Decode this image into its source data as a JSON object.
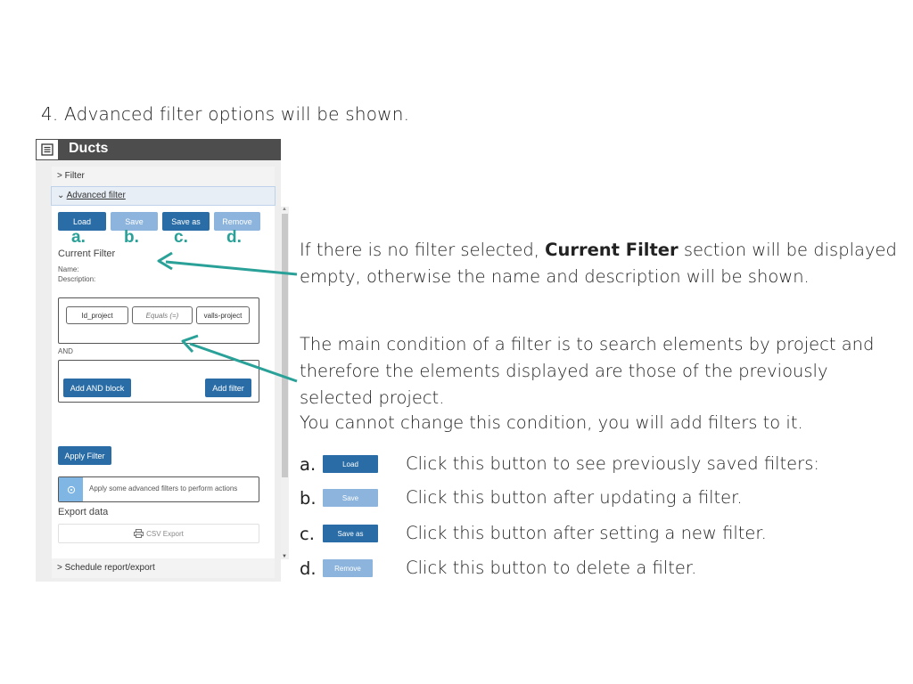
{
  "step_text": "4. Advanced filter options will be shown.",
  "panel": {
    "title": "Ducts",
    "filter_row": "> Filter",
    "advanced_chevron": "⌄",
    "advanced_label": "Advanced filter",
    "buttons": {
      "load": "Load",
      "save": "Save",
      "save_as": "Save as",
      "remove": "Remove"
    },
    "letters": [
      "a.",
      "b.",
      "c.",
      "d."
    ],
    "current_filter": {
      "title": "Current Filter",
      "name_label": "Name:",
      "description_label": "Description:"
    },
    "condition": {
      "field": "Id_project",
      "operator": "Equals (=)",
      "value": "valls-project"
    },
    "and_label": "AND",
    "add_and_block": "Add AND block",
    "add_filter": "Add filter",
    "apply_filter": "Apply Filter",
    "notice_text": "Apply some advanced filters to perform actions",
    "export_title": "Export data",
    "csv_export": "CSV Export",
    "schedule_row": "> Schedule report/export"
  },
  "paragraphs": {
    "p1_before": "If there is no filter selected, ",
    "p1_bold": "Current Filter",
    "p1_after": " section will be displayed empty, otherwise the name and description will be shown.",
    "p2": "The main condition of a filter is to search elements by project and therefore the elements displayed are those of the previously selected project.",
    "p3": "You cannot change this condition, you will add filters to it."
  },
  "legend": [
    {
      "letter": "a.",
      "button": "Load",
      "text": "Click this button to see previously saved filters:"
    },
    {
      "letter": "b.",
      "button": "Save",
      "text": "Click this button after updating a filter."
    },
    {
      "letter": "c.",
      "button": "Save as",
      "text": "Click this button after setting a new filter."
    },
    {
      "letter": "d.",
      "button": "Remove",
      "text": "Click this button to delete a filter."
    }
  ],
  "colors": {
    "accent_teal": "#2aa198",
    "button_dark": "#2a6da6",
    "button_light": "#8cb4dc",
    "header_gray": "#4d4d4d"
  },
  "icons": {
    "panel": "list-icon",
    "notice": "info-icon",
    "csv": "printer-icon"
  }
}
